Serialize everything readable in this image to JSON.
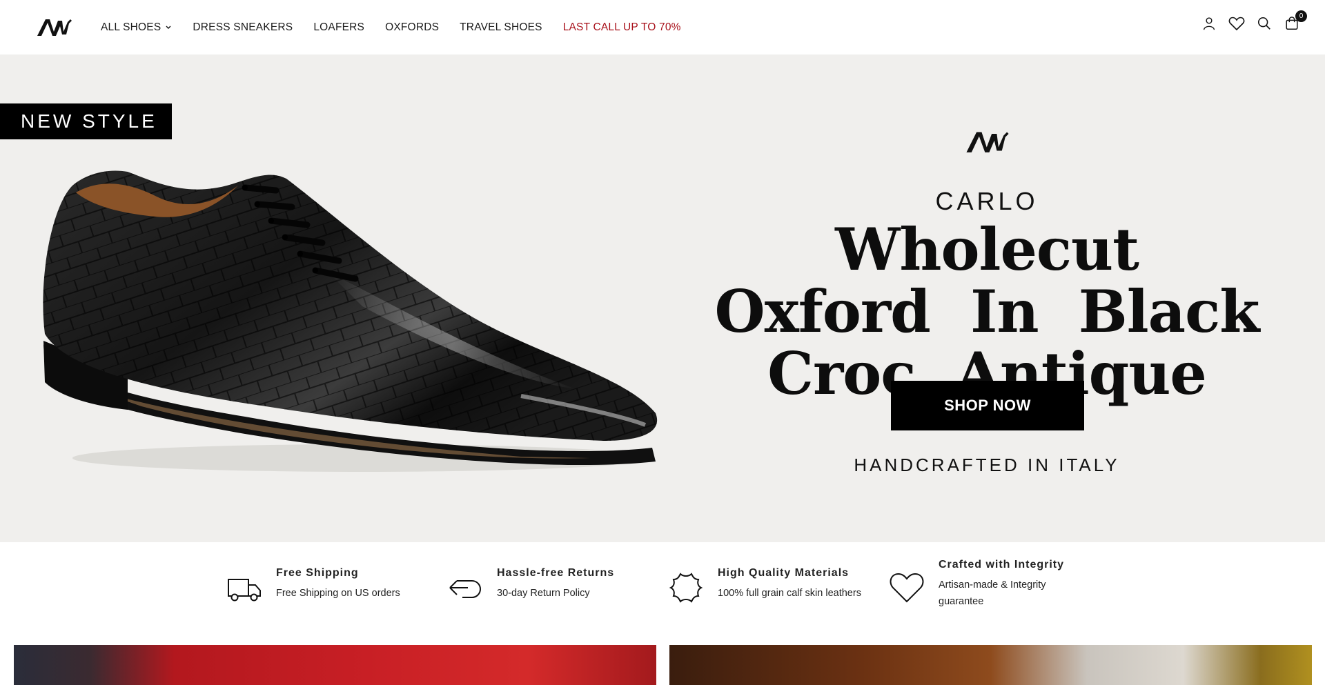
{
  "header": {
    "logo_alt": "AM logo",
    "nav": [
      {
        "label": "ALL SHOES",
        "has_dropdown": true
      },
      {
        "label": "DRESS SNEAKERS"
      },
      {
        "label": "LOAFERS"
      },
      {
        "label": "OXFORDS"
      },
      {
        "label": "TRAVEL SHOES"
      },
      {
        "label": "LAST CALL UP TO 70%",
        "highlight": true
      }
    ],
    "icons": [
      "account-icon",
      "wishlist-heart-icon",
      "search-icon",
      "cart-bag-icon"
    ],
    "cart_count": "0",
    "sale_color": "#a8101a"
  },
  "hero": {
    "badge": "NEW STYLE",
    "brand": "CARLO",
    "title": "Wholecut Oxford In Black Croc Antique",
    "cta": "SHOP NOW",
    "tagline": "HANDCRAFTED IN ITALY",
    "background": "#f0efed"
  },
  "features": [
    {
      "icon": "truck-icon",
      "title": "Free Shipping",
      "desc": "Free Shipping on US orders"
    },
    {
      "icon": "return-arrow-icon",
      "title": "Hassle-free Returns",
      "desc": "30-day Return Policy"
    },
    {
      "icon": "leather-hide-icon",
      "title": "High Quality Materials",
      "desc": "100% full grain calf skin leathers"
    },
    {
      "icon": "heart-icon",
      "title": "Crafted with Integrity",
      "desc": "Artisan-made & Integrity guarantee"
    }
  ]
}
